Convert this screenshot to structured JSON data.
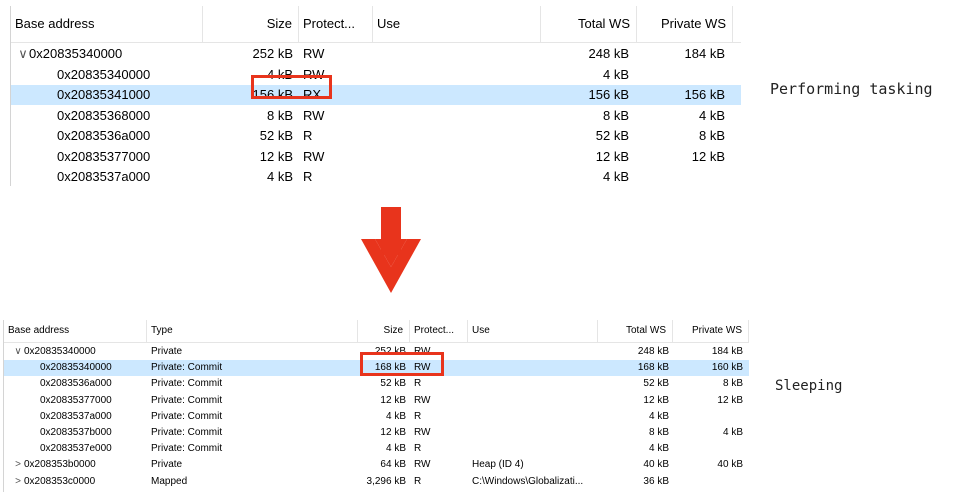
{
  "top_table": {
    "headers": {
      "base": "Base address",
      "size": "Size",
      "protect": "Protect...",
      "use": "Use",
      "total_ws": "Total WS",
      "private_ws": "Private WS"
    },
    "rows": [
      {
        "chev": "∨",
        "base": "0x20835340000",
        "size": "252 kB",
        "protect": "RW",
        "use": "",
        "total_ws": "248 kB",
        "private_ws": "184 kB"
      },
      {
        "chev": "",
        "base": "0x20835340000",
        "size": "4 kB",
        "protect": "RW",
        "use": "",
        "total_ws": "4 kB",
        "private_ws": ""
      },
      {
        "chev": "",
        "base": "0x20835341000",
        "size": "156 kB",
        "protect": "RX",
        "use": "",
        "total_ws": "156 kB",
        "private_ws": "156 kB"
      },
      {
        "chev": "",
        "base": "0x20835368000",
        "size": "8 kB",
        "protect": "RW",
        "use": "",
        "total_ws": "8 kB",
        "private_ws": "4 kB"
      },
      {
        "chev": "",
        "base": "0x2083536a000",
        "size": "52 kB",
        "protect": "R",
        "use": "",
        "total_ws": "52 kB",
        "private_ws": "8 kB"
      },
      {
        "chev": "",
        "base": "0x20835377000",
        "size": "12 kB",
        "protect": "RW",
        "use": "",
        "total_ws": "12 kB",
        "private_ws": "12 kB"
      },
      {
        "chev": "",
        "base": "0x2083537a000",
        "size": "4 kB",
        "protect": "R",
        "use": "",
        "total_ws": "4 kB",
        "private_ws": ""
      }
    ]
  },
  "top_label": "Performing tasking",
  "bottom_table": {
    "headers": {
      "base": "Base address",
      "type": "Type",
      "size": "Size",
      "protect": "Protect...",
      "use": "Use",
      "total_ws": "Total WS",
      "private_ws": "Private WS"
    },
    "rows": [
      {
        "chev": "∨",
        "base": "0x20835340000",
        "type": "Private",
        "size": "252 kB",
        "protect": "RW",
        "use": "",
        "total_ws": "248 kB",
        "private_ws": "184 kB"
      },
      {
        "chev": "",
        "base": "0x20835340000",
        "type": "Private: Commit",
        "size": "168 kB",
        "protect": "RW",
        "use": "",
        "total_ws": "168 kB",
        "private_ws": "160 kB"
      },
      {
        "chev": "",
        "base": "0x2083536a000",
        "type": "Private: Commit",
        "size": "52 kB",
        "protect": "R",
        "use": "",
        "total_ws": "52 kB",
        "private_ws": "8 kB"
      },
      {
        "chev": "",
        "base": "0x20835377000",
        "type": "Private: Commit",
        "size": "12 kB",
        "protect": "RW",
        "use": "",
        "total_ws": "12 kB",
        "private_ws": "12 kB"
      },
      {
        "chev": "",
        "base": "0x2083537a000",
        "type": "Private: Commit",
        "size": "4 kB",
        "protect": "R",
        "use": "",
        "total_ws": "4 kB",
        "private_ws": ""
      },
      {
        "chev": "",
        "base": "0x2083537b000",
        "type": "Private: Commit",
        "size": "12 kB",
        "protect": "RW",
        "use": "",
        "total_ws": "8 kB",
        "private_ws": "4 kB"
      },
      {
        "chev": "",
        "base": "0x2083537e000",
        "type": "Private: Commit",
        "size": "4 kB",
        "protect": "R",
        "use": "",
        "total_ws": "4 kB",
        "private_ws": ""
      },
      {
        "chev": ">",
        "base": "0x208353b0000",
        "type": "Private",
        "size": "64 kB",
        "protect": "RW",
        "use": "Heap (ID 4)",
        "total_ws": "40 kB",
        "private_ws": "40 kB"
      },
      {
        "chev": ">",
        "base": "0x208353c0000",
        "type": "Mapped",
        "size": "3,296 kB",
        "protect": "R",
        "use": "C:\\Windows\\Globalizati...",
        "total_ws": "36 kB",
        "private_ws": ""
      }
    ]
  },
  "bottom_label": "Sleeping",
  "colors": {
    "selection": "#cce8ff",
    "highlight_box": "#e8341c",
    "arrow": "#e8341c"
  },
  "icons": {
    "down_arrow": "down-arrow-icon",
    "expand": "chevron-down-icon",
    "collapse": "chevron-right-icon"
  }
}
